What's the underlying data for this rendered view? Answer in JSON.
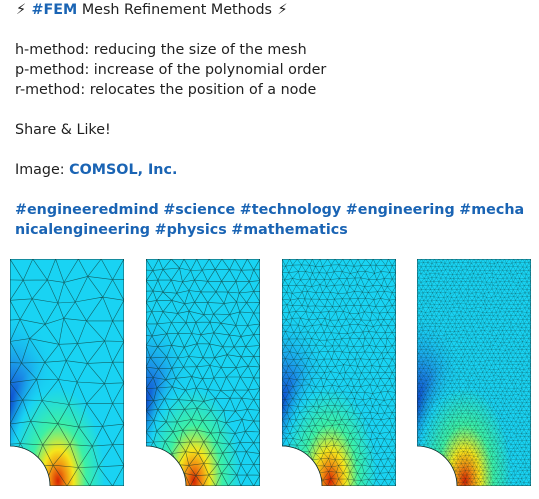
{
  "post": {
    "title": {
      "bolt_left": "⚡",
      "hashtag": "#FEM",
      "text": " Mesh Refinement Methods ",
      "bolt_right": "⚡"
    },
    "methods": [
      "h-method: reducing the size of the mesh",
      "p-method: increase of the polynomial order",
      "r-method: relocates the position of a node"
    ],
    "cta": "Share & Like!",
    "credit_prefix": "Image: ",
    "credit_link": "COMSOL, Inc.",
    "hashtags": [
      "#engineeredmind",
      "#science",
      "#technology",
      "#engineering",
      "#mechanicalengineering",
      "#physics",
      "#mathematics"
    ]
  },
  "images": {
    "panels": [
      {
        "name": "mesh-coarse",
        "density": 5
      },
      {
        "name": "mesh-medium",
        "density": 9
      },
      {
        "name": "mesh-fine",
        "density": 15
      },
      {
        "name": "mesh-finest",
        "density": 26
      }
    ],
    "colors": {
      "background_field": "#19d3f3",
      "hot": "#d62300",
      "warm": "#f5e61c",
      "cool": "#3cf0a6",
      "cold": "#0a3cc8",
      "link": "#1a64b4"
    }
  }
}
